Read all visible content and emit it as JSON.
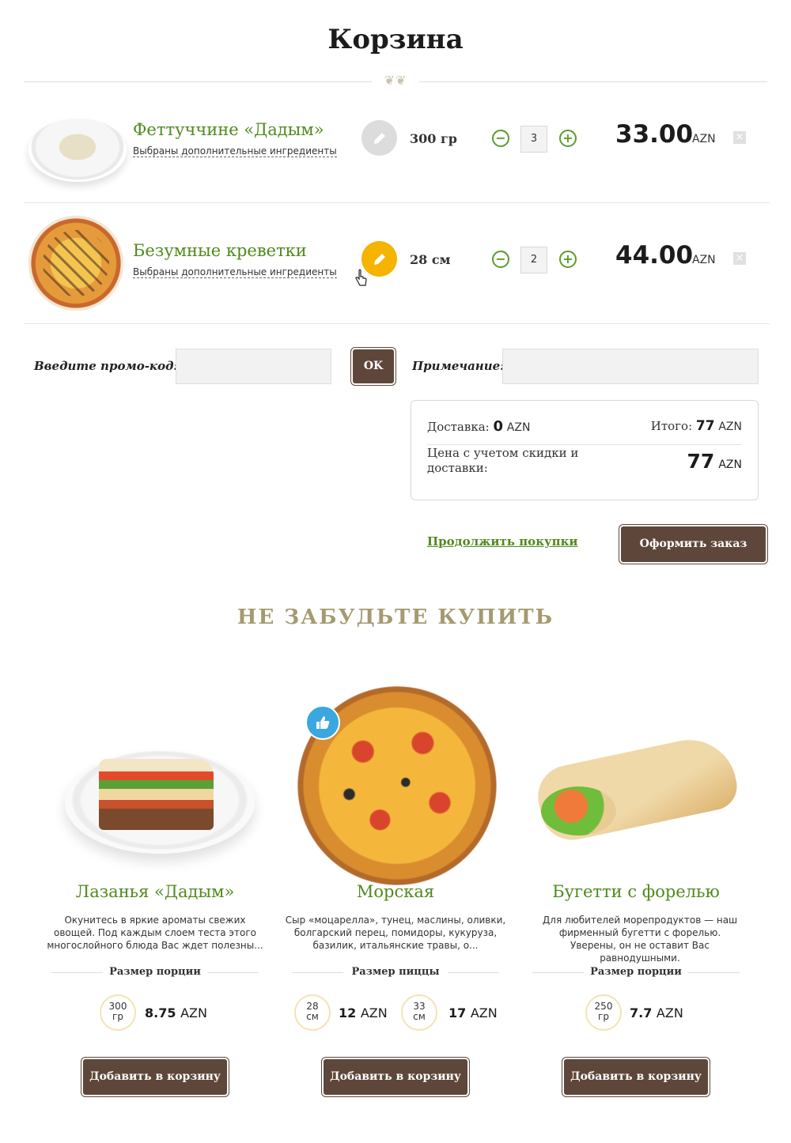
{
  "page": {
    "title": "Корзина"
  },
  "cart": {
    "items": [
      {
        "name": "Феттуччине «Дадым»",
        "subtitle": "Выбраны дополнительные ингредиенты",
        "size": "300 гр",
        "qty": "3",
        "price": "33.00",
        "currency": "AZN",
        "edit_state": "inactive"
      },
      {
        "name": "Безумные креветки",
        "subtitle": "Выбраны дополнительные ингредиенты",
        "size": "28 см",
        "qty": "2",
        "price": "44.00",
        "currency": "AZN",
        "edit_state": "active"
      }
    ],
    "minus_symbol": "−",
    "plus_symbol": "+",
    "remove_symbol": "×"
  },
  "promo": {
    "label": "Введите промо-код:",
    "value": "",
    "ok_label": "OK"
  },
  "note": {
    "label": "Примечание:",
    "value": ""
  },
  "summary": {
    "delivery_label": "Доставка:",
    "delivery_value": "0",
    "total_label": "Итого:",
    "total_value": "77",
    "discount_label": "Цена с учетом скидки и доставки:",
    "discount_value": "77",
    "currency": "AZN"
  },
  "actions": {
    "continue_label": "Продолжить покупки",
    "checkout_label": "Оформить заказ"
  },
  "upsell": {
    "title": "НЕ ЗАБУДЬТЕ КУПИТЬ",
    "add_label": "Добавить в корзину",
    "products": [
      {
        "name": "Лазанья «Дадым»",
        "desc": "Окунитесь в яркие ароматы свежих овощей. Под каждым слоем теста этого многослойного блюда Вас ждет полезны...",
        "size_label": "Размер порции",
        "options": [
          {
            "amount": "300",
            "unit": "гр",
            "price": "8.75",
            "currency": "AZN"
          }
        ]
      },
      {
        "name": "Морская",
        "desc": "Сыр «моцарелла», тунец, маслины, оливки, болгарский перец, помидоры, кукуруза, базилик, итальянские травы, о...",
        "size_label": "Размер пиццы",
        "options": [
          {
            "amount": "28",
            "unit": "см",
            "price": "12",
            "currency": "AZN"
          },
          {
            "amount": "33",
            "unit": "см",
            "price": "17",
            "currency": "AZN"
          }
        ]
      },
      {
        "name": "Бугетти с форелью",
        "desc": "Для любителей морепродуктов — наш фирменный бугетти с форелью. Уверены, он не оставит Вас равнодушными.",
        "size_label": "Размер порции",
        "options": [
          {
            "amount": "250",
            "unit": "гр",
            "price": "7.7",
            "currency": "AZN"
          }
        ]
      }
    ]
  },
  "icons": {
    "edit": "pencil-icon",
    "minus": "minus-circle-icon",
    "plus": "plus-circle-icon",
    "remove": "close-icon",
    "like": "thumbs-up-icon",
    "cursor": "hand-pointer-icon"
  },
  "colors": {
    "accent_green": "#4f8a1d",
    "button_brown": "#5e473a",
    "section_title": "#a59a6f",
    "edit_active": "#f4b400",
    "like_badge": "#3aa7e0"
  }
}
